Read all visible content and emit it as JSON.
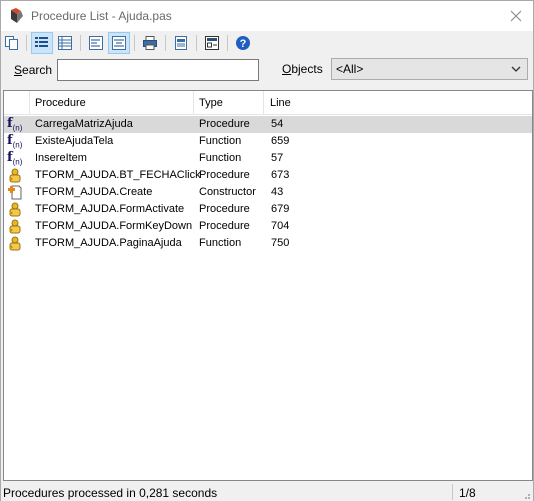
{
  "window": {
    "title": "Procedure List - Ajuda.pas"
  },
  "toolbar": {
    "buttons": [
      {
        "icon": "copy-icon"
      },
      {
        "icon": "list-view-icon"
      },
      {
        "icon": "detail-view-icon"
      },
      {
        "icon": "align-left-icon"
      },
      {
        "icon": "align-center-icon"
      },
      {
        "icon": "print-icon"
      },
      {
        "icon": "print-preview-icon"
      },
      {
        "icon": "options-icon"
      },
      {
        "icon": "help-icon"
      }
    ]
  },
  "search": {
    "label_first": "S",
    "label_rest": "earch",
    "value": "",
    "placeholder": ""
  },
  "objects": {
    "label_first": "O",
    "label_rest": "bjects",
    "selected": "<All>"
  },
  "list": {
    "columns": [
      "Procedure",
      "Type",
      "Line"
    ],
    "rows": [
      {
        "icon": "function-icon",
        "procedure": "CarregaMatrizAjuda",
        "type": "Procedure",
        "line": "54",
        "selected": true
      },
      {
        "icon": "function-icon",
        "procedure": "ExisteAjudaTela",
        "type": "Function",
        "line": "659"
      },
      {
        "icon": "function-icon",
        "procedure": "InsereItem",
        "type": "Function",
        "line": "57"
      },
      {
        "icon": "method-icon",
        "procedure": "TFORM_AJUDA.BT_FECHAClick",
        "type": "Procedure",
        "line": "673"
      },
      {
        "icon": "constructor-icon",
        "procedure": "TFORM_AJUDA.Create",
        "type": "Constructor",
        "line": "43"
      },
      {
        "icon": "method-icon",
        "procedure": "TFORM_AJUDA.FormActivate",
        "type": "Procedure",
        "line": "679"
      },
      {
        "icon": "method-icon",
        "procedure": "TFORM_AJUDA.FormKeyDown",
        "type": "Procedure",
        "line": "704"
      },
      {
        "icon": "method-icon",
        "procedure": "TFORM_AJUDA.PaginaAjuda",
        "type": "Function",
        "line": "750"
      }
    ]
  },
  "status": {
    "message": "Procedures processed in 0,281 seconds",
    "count": "1/8"
  },
  "colors": {
    "selected_row": "#d9d9d9",
    "pressed_button": "#cce4f7",
    "help_blue": "#1e5fc2"
  }
}
